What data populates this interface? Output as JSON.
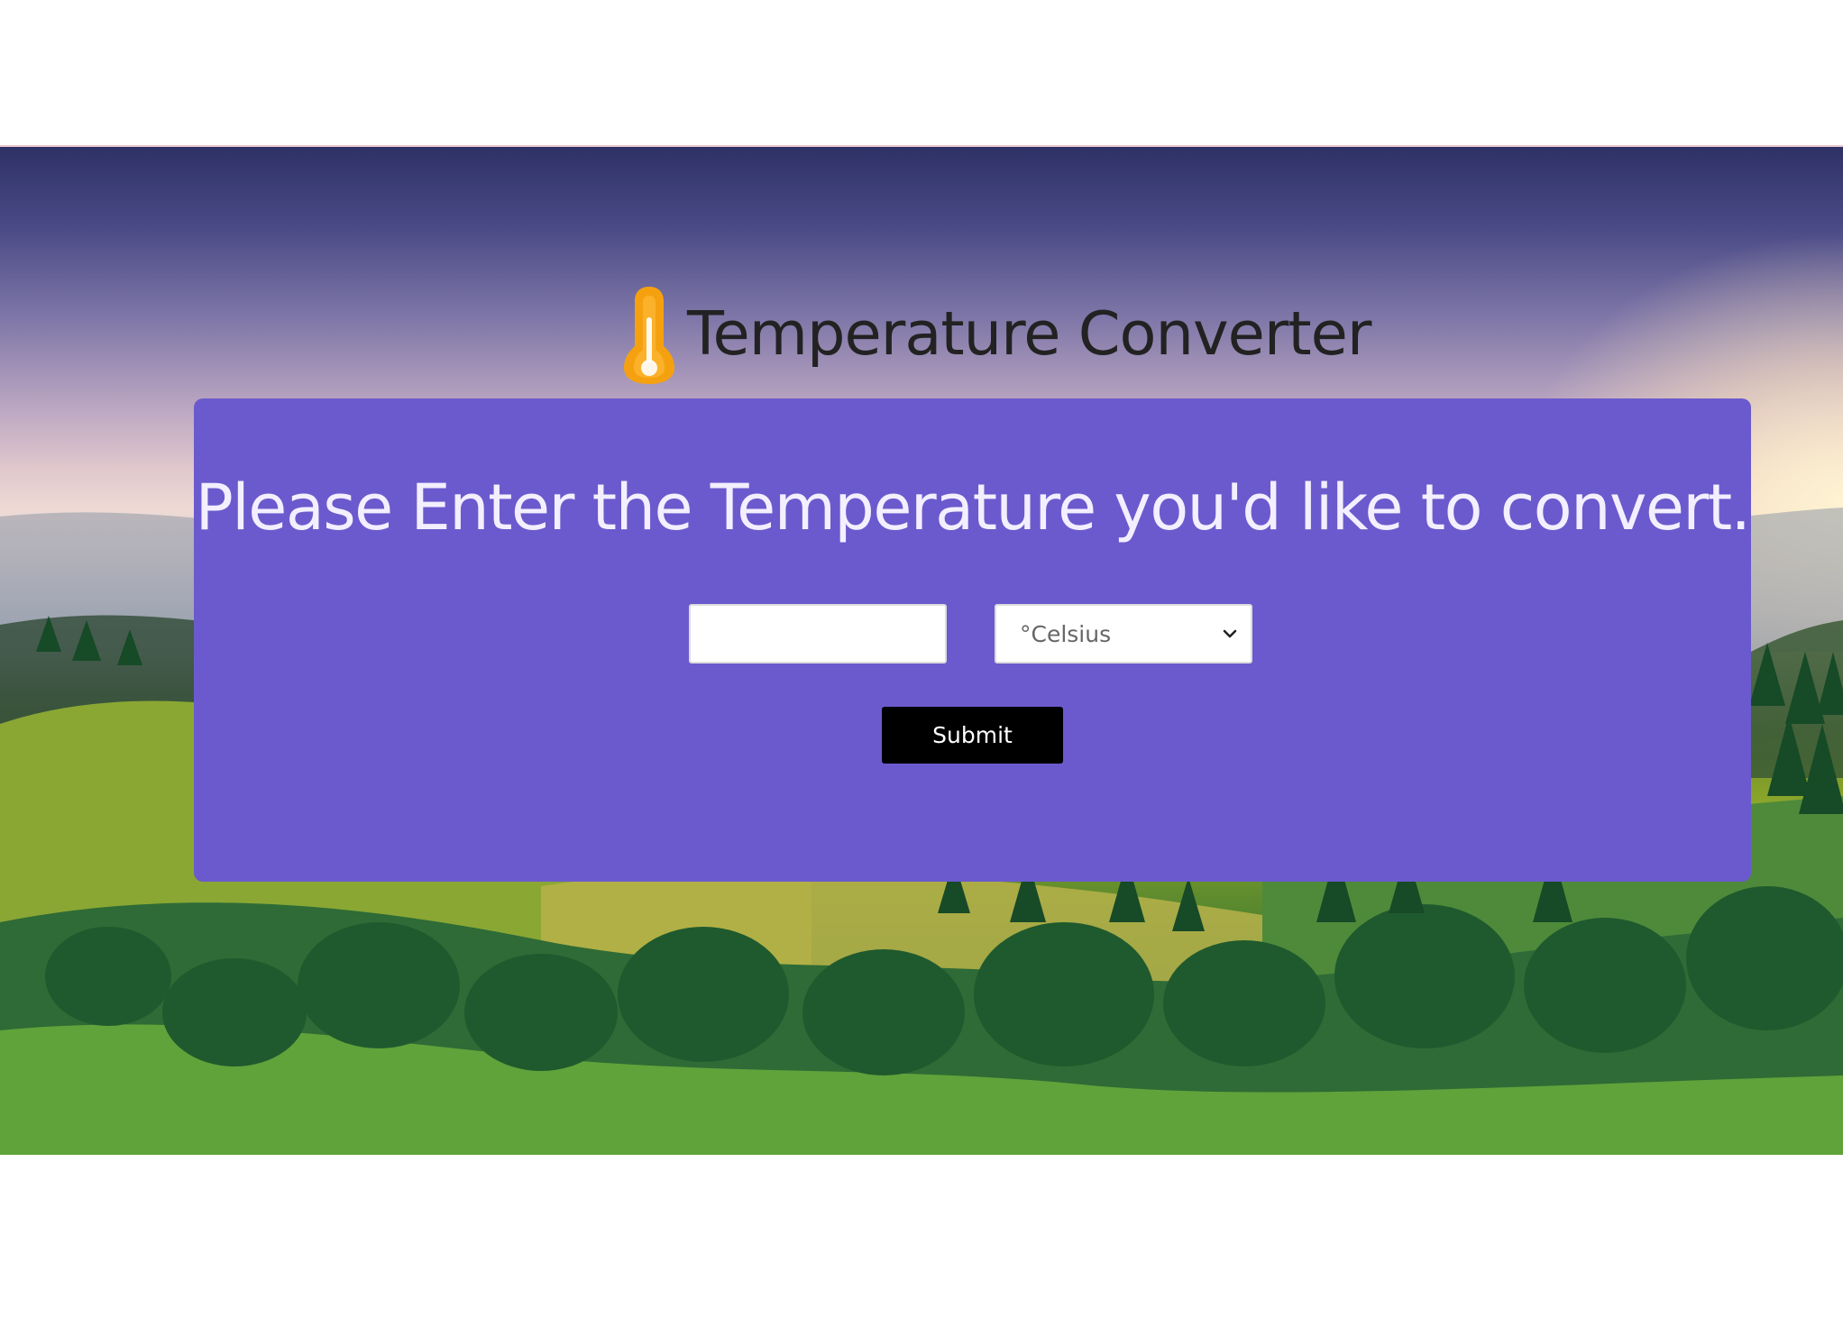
{
  "header": {
    "title": "Temperature Converter",
    "icon": "thermometer-icon",
    "icon_color": "#f5a10f"
  },
  "form": {
    "prompt": "Please Enter the Temperature you'd like to convert.",
    "temperature_input": {
      "value": "",
      "placeholder": ""
    },
    "unit_select": {
      "selected": "°Celsius"
    },
    "submit_label": "Submit"
  },
  "colors": {
    "card_background": "#6b5acd",
    "prompt_text": "#f3efff",
    "submit_background": "#000000"
  }
}
